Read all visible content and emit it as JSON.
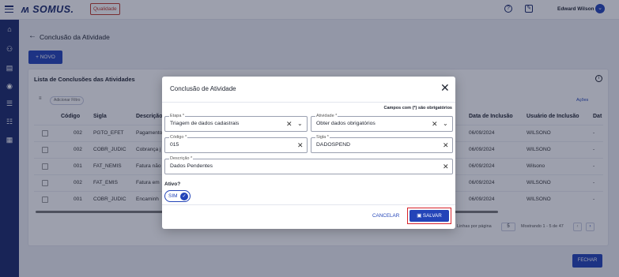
{
  "header": {
    "logo_text": "ʍ SOMUS.",
    "env_badge": "Qualidade",
    "user_name": "Edward Wilson",
    "avatar_glyph": "⌄"
  },
  "page": {
    "title": "Conclusão da Atividade",
    "new_button": "+  NOVO",
    "card_title": "Lista de Conclusões das Atividades",
    "filter_chip": "Adicionar Filtro",
    "actions_label": "Ações",
    "close_button": "FECHAR"
  },
  "table": {
    "columns": [
      "Código",
      "Sigla",
      "Descrição",
      "Data de Inclusão",
      "Usuário de Inclusão",
      "Dat"
    ],
    "rows": [
      {
        "code": "002",
        "sigla": "PGTO_EFET",
        "desc": "Pagamento",
        "date": "06/09/2024",
        "user": "WILSONO",
        "dat": "-"
      },
      {
        "code": "002",
        "sigla": "COBR_JUDIC",
        "desc": "Cobrança j",
        "date": "06/09/2024",
        "user": "WILSONO",
        "dat": "-"
      },
      {
        "code": "001",
        "sigla": "FAT_NEMIS",
        "desc": "Fatura não",
        "date": "06/09/2024",
        "user": "Wilsono",
        "dat": "-"
      },
      {
        "code": "002",
        "sigla": "FAT_EMIS",
        "desc": "Fatura em",
        "date": "06/09/2024",
        "user": "WILSONO",
        "dat": "-"
      },
      {
        "code": "001",
        "sigla": "COBR_JUDIC",
        "desc": "Encaminh",
        "date": "06/09/2024",
        "user": "WILSONO",
        "dat": "-"
      }
    ]
  },
  "pagination": {
    "rows_per_page_label": "Linhas por página",
    "rows_per_page_value": "5",
    "range_text": "Mostrando 1 - 5 de 47"
  },
  "modal": {
    "title": "Conclusão de Atividade",
    "required_note": "Campos com (*) são obrigatórios",
    "fields": {
      "etapa": {
        "label": "Etapa *",
        "value": "Triagem de dados cadastrais"
      },
      "atividade": {
        "label": "Atividade *",
        "value": "Obter dados obrigatórios"
      },
      "codigo": {
        "label": "Código *",
        "value": "015"
      },
      "sigla": {
        "label": "Sigla *",
        "value": "DADOSPEND"
      },
      "descricao": {
        "label": "Descrição *",
        "value": "Dados Pendentes"
      }
    },
    "ativo_label": "Ativo?",
    "toggle_text": "SIM",
    "cancel_button": "CANCELAR",
    "save_button": "SALVAR"
  },
  "colors": {
    "primary": "#2344b8",
    "sidebar": "#1b2a6b",
    "highlight": "#d7232b"
  }
}
